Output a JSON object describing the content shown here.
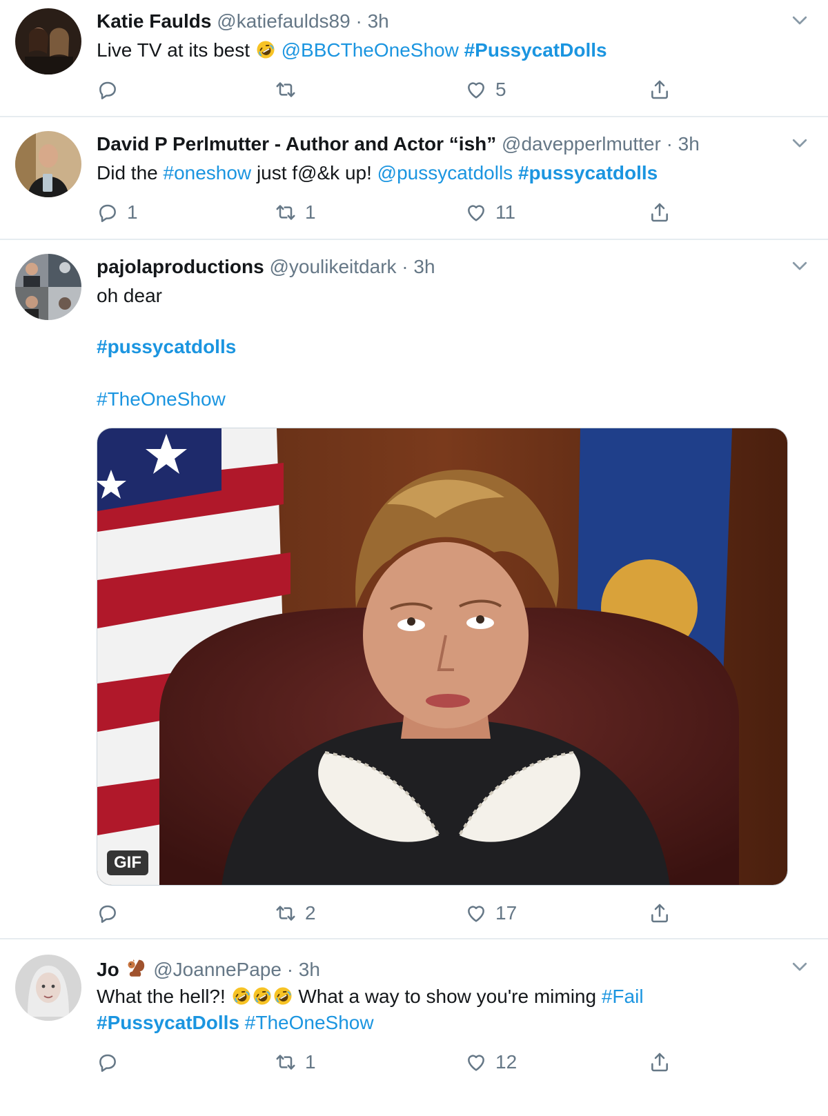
{
  "colors": {
    "link": "#1b95e0",
    "secondary": "#657786",
    "divider": "#e6ecf0"
  },
  "tweets": [
    {
      "name": "Katie Faulds",
      "handle": "@katiefaulds89 · 3h",
      "text_pre": "Live TV at its best",
      "mention": "@BBCTheOneShow",
      "hashtag": "#PussycatDolls",
      "replies": "",
      "retweets": "",
      "likes": "5"
    },
    {
      "name": "David P Perlmutter - Author and Actor “ish”",
      "handle": "@davepperlmutter · 3h",
      "text_pre": "Did the",
      "hashtag1": "#oneshow",
      "text_mid": "just f@&k up!",
      "mention": "@pussycatdolls",
      "hashtag2": "#pussycatdolls",
      "replies": "1",
      "retweets": "1",
      "likes": "11"
    },
    {
      "name": "pajolaproductions",
      "handle": "@youlikeitdark · 3h",
      "text": "oh dear",
      "hashtag1": "#pussycatdolls",
      "hashtag2": "#TheOneShow",
      "media_badge": "GIF",
      "replies": "",
      "retweets": "2",
      "likes": "17"
    },
    {
      "name": "Jo",
      "handle": "@JoannePape · 3h",
      "text_pre": "What the hell?!",
      "text_mid": "What a way to show you're miming",
      "hashtag1": "#Fail",
      "hashtag2": "#PussycatDolls",
      "hashtag3": "#TheOneShow",
      "replies": "",
      "retweets": "1",
      "likes": "12"
    }
  ],
  "icons": {
    "reply": "reply-icon",
    "retweet": "retweet-icon",
    "like": "heart-icon",
    "share": "share-icon",
    "caret": "chevron-down-icon",
    "emoji": "rofl-emoji-icon",
    "squirrel": "squirrel-emoji-icon"
  }
}
